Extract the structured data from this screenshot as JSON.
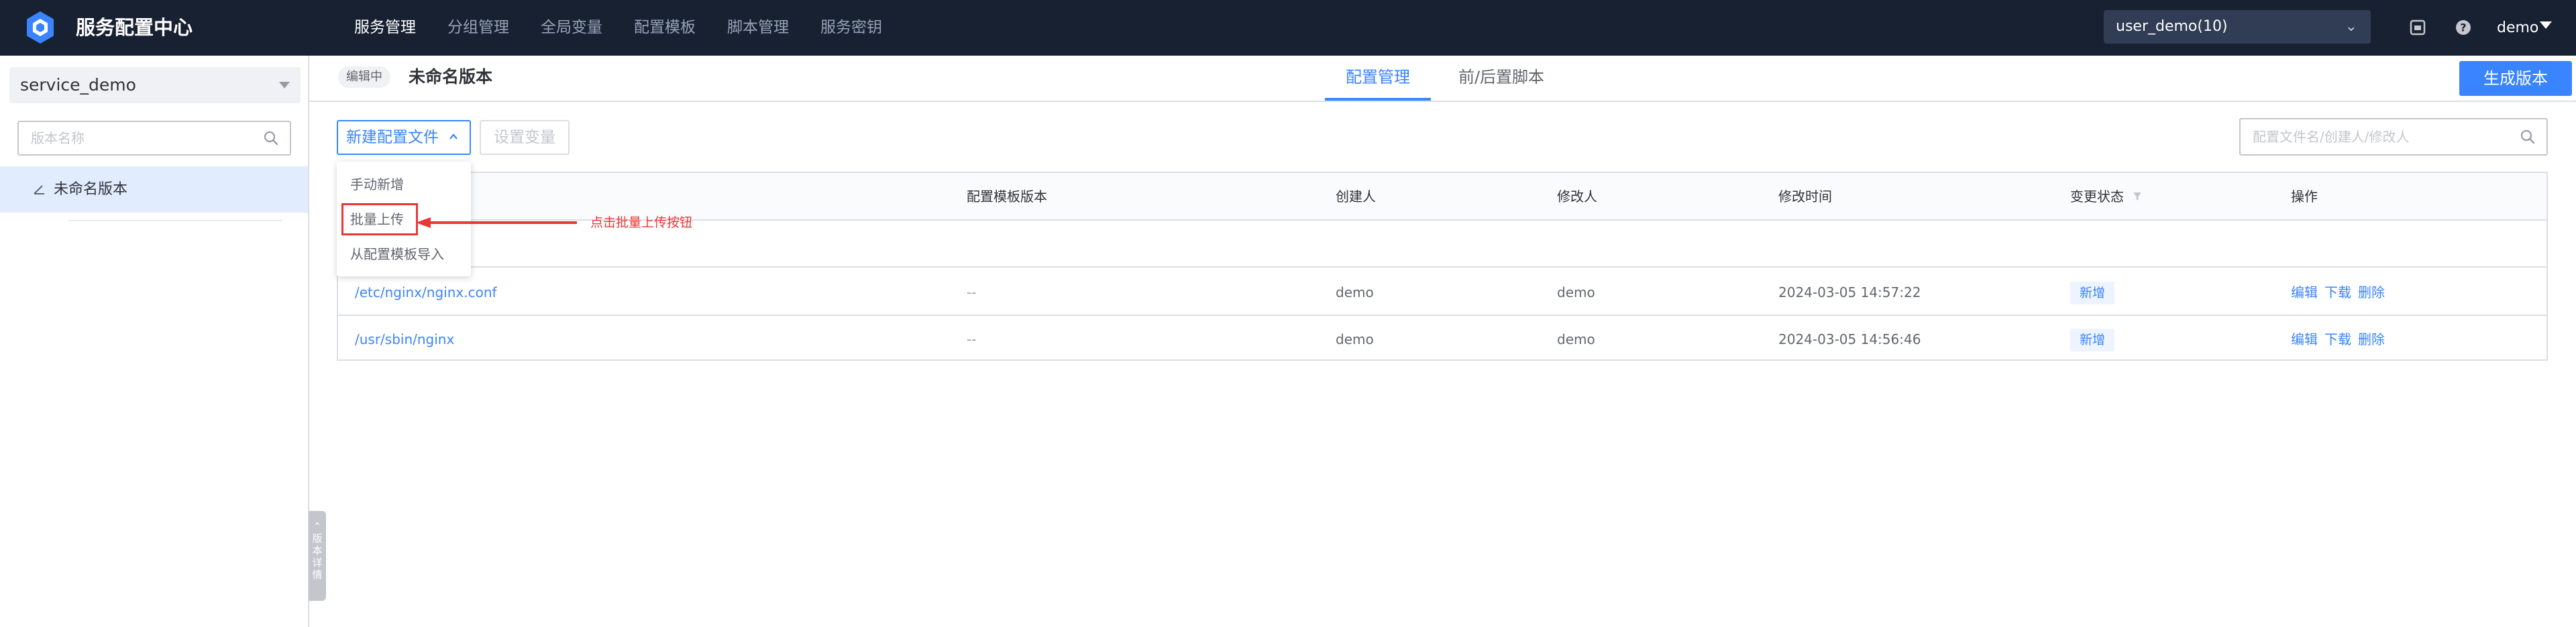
{
  "app": {
    "title": "服务配置中心",
    "nav": [
      "服务管理",
      "分组管理",
      "全局变量",
      "配置模板",
      "脚本管理",
      "服务密钥"
    ],
    "nav_active_index": 0,
    "business": "user_demo(10)",
    "user": "demo",
    "icons": [
      "app-logo-icon",
      "history-icon",
      "help-icon"
    ]
  },
  "sidebar": {
    "service": "service_demo",
    "search_placeholder": "版本名称",
    "versions": [
      {
        "name": "未命名版本",
        "selected": true,
        "icon": "edit-icon"
      }
    ],
    "collapse_label": "⌃版本详情"
  },
  "header": {
    "status_tag": "编辑中",
    "version_name": "未命名版本",
    "tabs": [
      {
        "label": "配置管理",
        "active": true
      },
      {
        "label": "前/后置脚本",
        "active": false
      }
    ],
    "publish_button": "生成版本"
  },
  "toolbar": {
    "new_config": "新建配置文件",
    "set_vars": "设置变量",
    "search_placeholder": "配置文件名/创建人/修改人"
  },
  "dropdown": {
    "items": [
      "手动新增",
      "批量上传",
      "从配置模板导入"
    ],
    "highlighted_index": 1
  },
  "annotation": {
    "text": "点击批量上传按钮",
    "color": "#ea3636"
  },
  "table": {
    "columns": [
      "配置模板版本",
      "创建人",
      "修改人",
      "修改时间",
      "变更状态",
      "操作"
    ],
    "rows": [
      {
        "path": "/etc/nginx/nginx.conf",
        "template_version": "--",
        "creator": "demo",
        "modifier": "demo",
        "modified_at": "2024-03-05 14:57:22",
        "status": "新增",
        "actions": [
          "编辑",
          "下载",
          "删除"
        ]
      },
      {
        "path": "/usr/sbin/nginx",
        "template_version": "--",
        "creator": "demo",
        "modifier": "demo",
        "modified_at": "2024-03-05 14:56:46",
        "status": "新增",
        "actions": [
          "编辑",
          "下载",
          "删除"
        ]
      }
    ]
  },
  "colors": {
    "primary": "#3a84ff",
    "topbar": "#182132",
    "danger": "#ea3636"
  }
}
